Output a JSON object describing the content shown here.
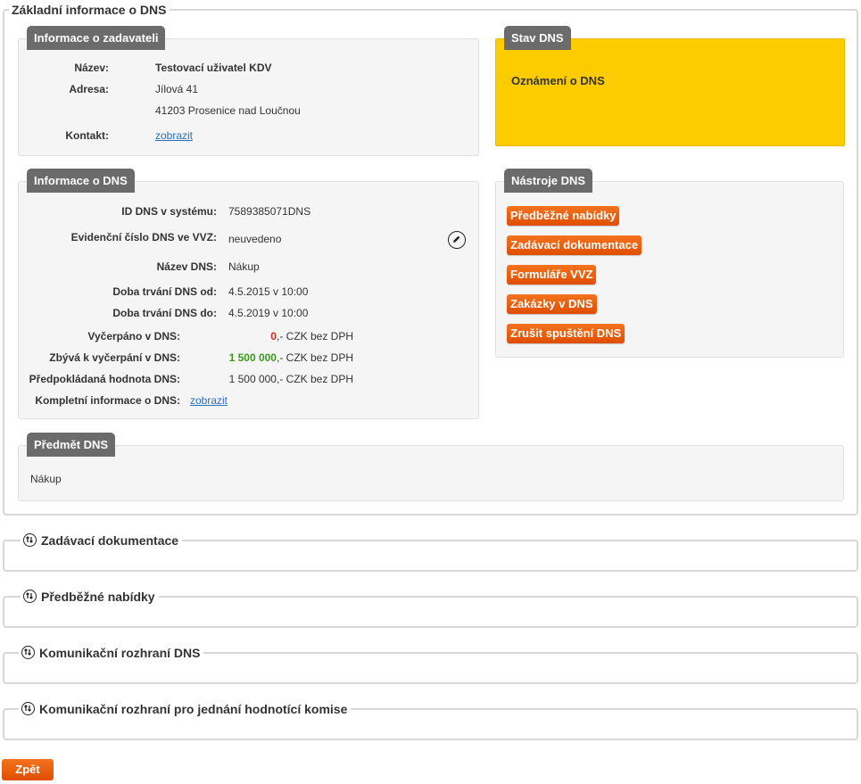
{
  "main_section": {
    "title": "Základní informace o DNS"
  },
  "zadavatel": {
    "tab": "Informace o zadavateli",
    "name_label": "Název:",
    "name_value": "Testovací uživatel KDV",
    "address_label": "Adresa:",
    "address_line1": "Jílová 41",
    "address_line2": "41203 Prosenice nad Loučnou",
    "contact_label": "Kontakt:",
    "contact_link": "zobrazit"
  },
  "stav": {
    "tab": "Stav DNS",
    "text": "Oznámení o DNS",
    "color": "#fccc00"
  },
  "dns_info": {
    "tab": "Informace o DNS",
    "rows": [
      {
        "label": "ID DNS v systému:",
        "value": "7589385071DNS"
      },
      {
        "label": "Evidenční číslo DNS ve VVZ:",
        "value": "neuvedeno"
      },
      {
        "label": "Název DNS:",
        "value": "Nákup"
      },
      {
        "label": "Doba trvání DNS od:",
        "value": "4.5.2015 v 10:00"
      },
      {
        "label": "Doba trvání DNS do:",
        "value": "4.5.2019 v 10:00"
      }
    ],
    "vycerpano_label": "Vyčerpáno v DNS:",
    "vycerpano_amount": "0",
    "vycerpano_suffix": ",- CZK bez DPH",
    "zbyva_label": "Zbývá k vyčerpání v DNS:",
    "zbyva_amount": "1 500 000",
    "zbyva_suffix": ",- CZK bez DPH",
    "predpokladana_label": "Předpokládaná hodnota DNS:",
    "predpokladana_value": "1 500 000,- CZK bez DPH",
    "kompletni_label": "Kompletní informace o DNS:",
    "kompletni_link": "zobrazit",
    "red": "#d9261c",
    "green": "#3a9a1c"
  },
  "nastroje": {
    "tab": "Nástroje DNS",
    "buttons": [
      "Předběžné nabídky",
      "Zadávací dokumentace",
      "Formuláře VVZ",
      "Zakázky v DNS",
      "Zrušit spuštění DNS"
    ]
  },
  "predmet": {
    "tab": "Předmět DNS",
    "text": "Nákup"
  },
  "collapsed_sections": [
    "Zadávací dokumentace",
    "Předběžné nabídky",
    "Komunikační rozhraní DNS",
    "Komunikační rozhraní pro jednání hodnotící komise"
  ],
  "back_button": "Zpět",
  "accent": "#e85a0c",
  "icons": {
    "section_toggle": "expand-collapse-icon",
    "edit": "pencil-icon"
  }
}
